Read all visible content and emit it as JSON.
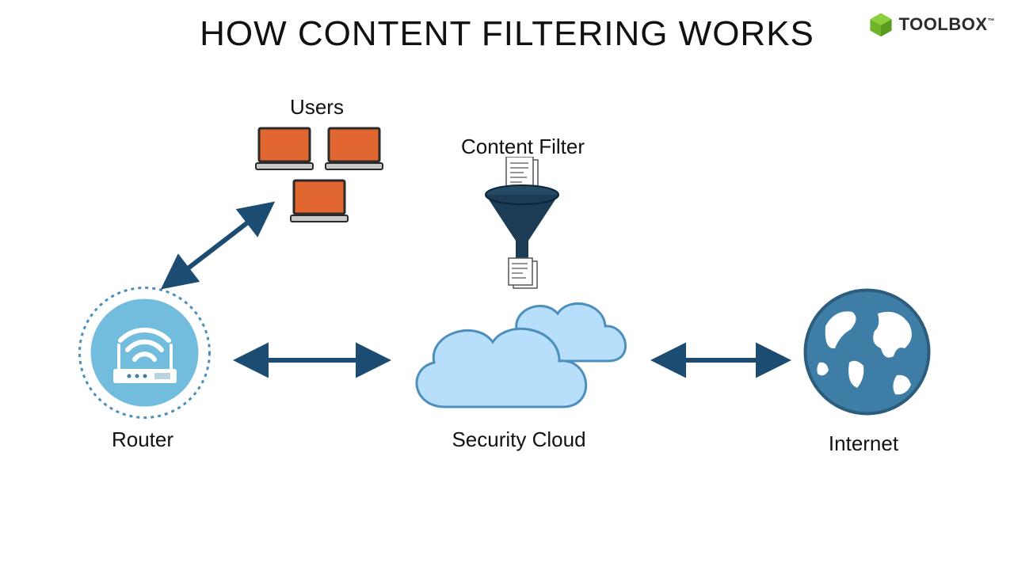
{
  "logo": {
    "text": "TOOLBOX",
    "tm": "™"
  },
  "title": "HOW CONTENT FILTERING WORKS",
  "nodes": {
    "users": {
      "label": "Users"
    },
    "content_filter": {
      "label": "Content Filter"
    },
    "router": {
      "label": "Router"
    },
    "security_cloud": {
      "label": "Security Cloud"
    },
    "internet": {
      "label": "Internet"
    }
  },
  "flow": [
    [
      "Users",
      "Router",
      "bidirectional"
    ],
    [
      "Router",
      "Security Cloud",
      "bidirectional"
    ],
    [
      "Content Filter",
      "Security Cloud",
      "filter"
    ],
    [
      "Security Cloud",
      "Internet",
      "bidirectional"
    ]
  ],
  "colors": {
    "arrow": "#1c4c72",
    "cloud_fill": "#b7defb",
    "cloud_stroke": "#4c8fbc",
    "router_bg": "#72bdde",
    "screen": "#e1662f",
    "globe": "#3e7da5",
    "funnel": "#1c3b55",
    "logo_green": "#6fb32a"
  }
}
